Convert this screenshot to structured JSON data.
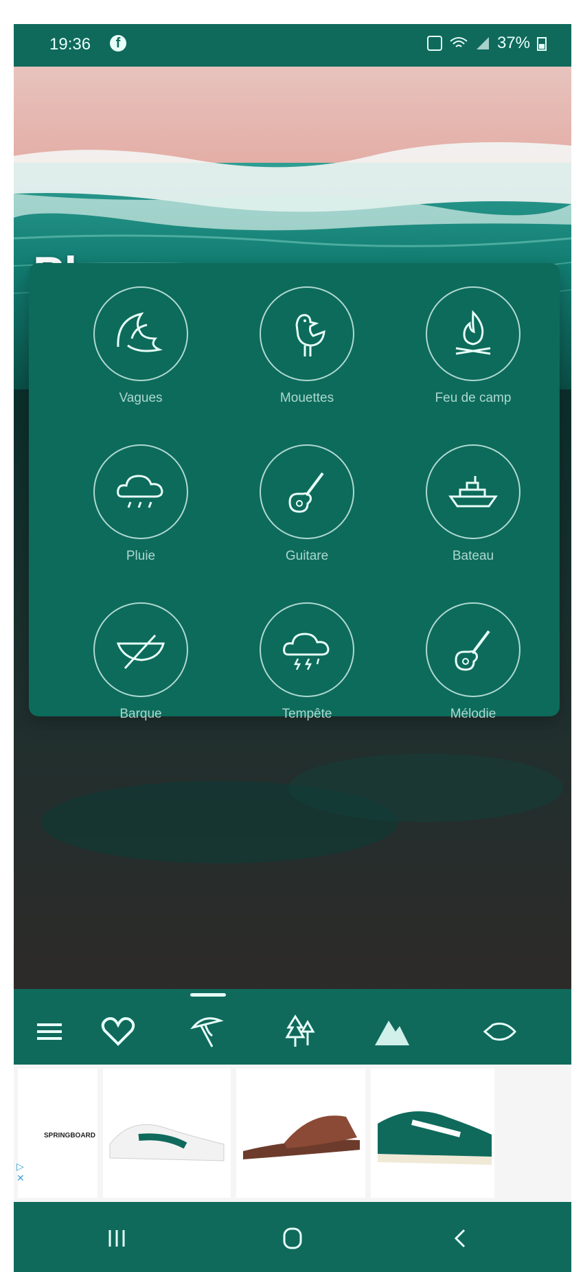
{
  "status_bar": {
    "time": "19:36",
    "battery": "37%"
  },
  "page": {
    "title": "Plage"
  },
  "sounds": [
    {
      "label": "Vagues",
      "icon": "wave-icon"
    },
    {
      "label": "Mouettes",
      "icon": "seagull-icon"
    },
    {
      "label": "Feu de camp",
      "icon": "campfire-icon"
    },
    {
      "label": "Pluie",
      "icon": "rain-cloud-icon"
    },
    {
      "label": "Guitare",
      "icon": "guitar-icon"
    },
    {
      "label": "Bateau",
      "icon": "ship-icon"
    },
    {
      "label": "Barque",
      "icon": "rowboat-icon"
    },
    {
      "label": "Tempête",
      "icon": "storm-cloud-icon"
    },
    {
      "label": "Mélodie",
      "icon": "guitar-icon"
    }
  ],
  "bottom_nav": {
    "items": [
      "menu-icon",
      "heart-icon",
      "beach-umbrella-icon",
      "forest-icon",
      "mountain-icon",
      "fish-icon"
    ]
  },
  "ad": {
    "brand": "SPRINGBOARD"
  },
  "colors": {
    "primary": "#0f6a5c",
    "panel": "#0d6b5b",
    "text_light": "#e8fff9"
  }
}
